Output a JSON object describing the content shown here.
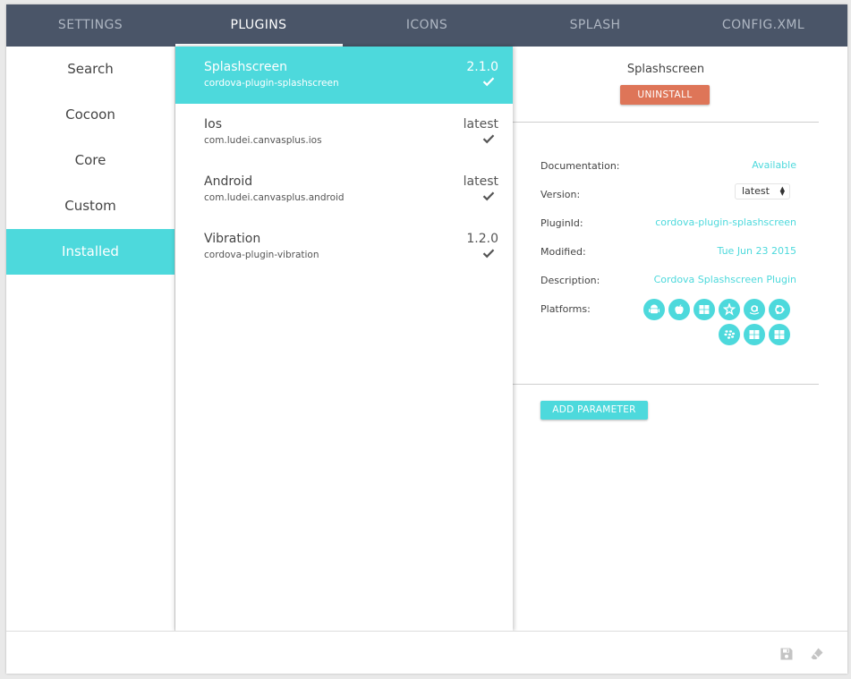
{
  "tabs": [
    {
      "label": "SETTINGS"
    },
    {
      "label": "PLUGINS"
    },
    {
      "label": "ICONS"
    },
    {
      "label": "SPLASH"
    },
    {
      "label": "CONFIG.XML"
    }
  ],
  "active_tab": "PLUGINS",
  "sidebar": {
    "items": [
      {
        "label": "Search"
      },
      {
        "label": "Cocoon"
      },
      {
        "label": "Core"
      },
      {
        "label": "Custom"
      },
      {
        "label": "Installed"
      }
    ],
    "active": "Installed"
  },
  "plugins": [
    {
      "name": "Splashscreen",
      "package": "cordova-plugin-splashscreen",
      "version": "2.1.0",
      "installed_icon": "check-icon"
    },
    {
      "name": "Ios",
      "package": "com.ludei.canvasplus.ios",
      "version": "latest",
      "installed_icon": "check-icon"
    },
    {
      "name": "Android",
      "package": "com.ludei.canvasplus.android",
      "version": "latest",
      "installed_icon": "check-icon"
    },
    {
      "name": "Vibration",
      "package": "cordova-plugin-vibration",
      "version": "1.2.0",
      "installed_icon": "check-icon"
    }
  ],
  "detail": {
    "title": "Splashscreen",
    "uninstall_label": "UNINSTALL",
    "documentation_label": "Documentation:",
    "documentation_value": "Available",
    "version_label": "Version:",
    "version_value": "latest",
    "pluginid_label": "PluginId:",
    "pluginid_value": "cordova-plugin-splashscreen",
    "modified_label": "Modified:",
    "modified_value": "Tue Jun 23 2015",
    "description_label": "Description:",
    "description_value": "Cordova Splashscreen Plugin",
    "platforms_label": "Platforms:",
    "platform_icons": [
      "android-icon",
      "apple-icon",
      "windows-icon",
      "firefox-os-icon",
      "amazon-icon",
      "ubuntu-icon",
      "blackberry-icon",
      "windows-icon",
      "windows-icon"
    ],
    "add_parameter_label": "ADD PARAMETER"
  },
  "footer": {
    "icons": [
      "save-icon",
      "eraser-icon"
    ]
  },
  "colors": {
    "accent": "#4dd9dc",
    "nav_bg": "#4a5568",
    "danger": "#de7558"
  }
}
